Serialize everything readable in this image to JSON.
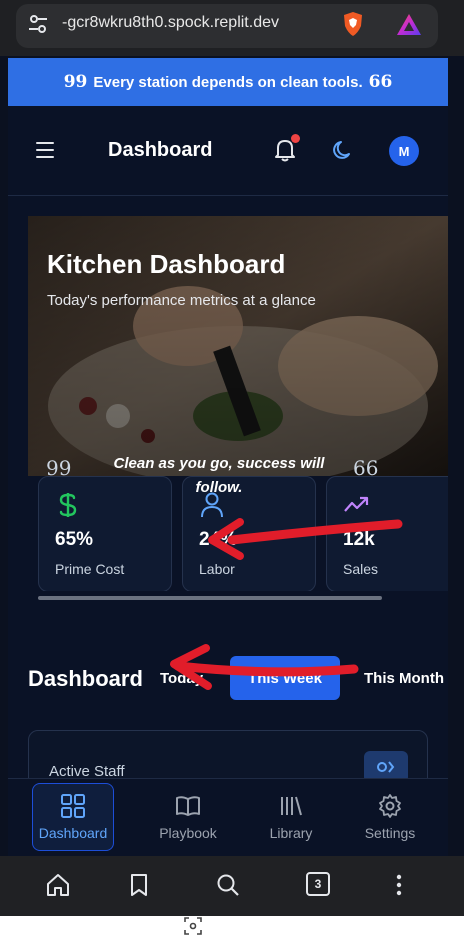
{
  "browser": {
    "url": "-gcr8wkru8th0.spock.replit.dev",
    "tab_count": "3"
  },
  "banner": {
    "text": "Every station depends on clean tools.",
    "open_quote": "99",
    "close_quote": "66"
  },
  "header": {
    "title": "Dashboard",
    "avatar_initial": "M"
  },
  "hero": {
    "title": "Kitchen Dashboard",
    "subtitle": "Today's performance metrics at a glance",
    "quote": "Clean as you go, success will follow.",
    "quote_open": "99",
    "quote_close": "66"
  },
  "metrics": [
    {
      "value": "65%",
      "label": "Prime Cost",
      "icon": "dollar-icon",
      "color": "#22c55e"
    },
    {
      "value": "24%",
      "label": "Labor",
      "icon": "person-icon",
      "color": "#60a5fa"
    },
    {
      "value": "12k",
      "label": "Sales",
      "icon": "trending-up-icon",
      "color": "#c084fc"
    }
  ],
  "section": {
    "title": "Dashboard",
    "tabs": [
      "Today",
      "This Week",
      "This Month"
    ],
    "active_tab": "This Week"
  },
  "staff_card": {
    "label": "Active Staff"
  },
  "bottom_nav": [
    {
      "label": "Dashboard",
      "icon": "grid-icon",
      "active": true
    },
    {
      "label": "Playbook",
      "icon": "book-icon",
      "active": false
    },
    {
      "label": "Library",
      "icon": "library-icon",
      "active": false
    },
    {
      "label": "Settings",
      "icon": "gear-icon",
      "active": false
    }
  ],
  "colors": {
    "accent": "#2563eb",
    "banner": "#2f6fe4",
    "background": "#0a1226",
    "annotation": "#e11d2a"
  }
}
